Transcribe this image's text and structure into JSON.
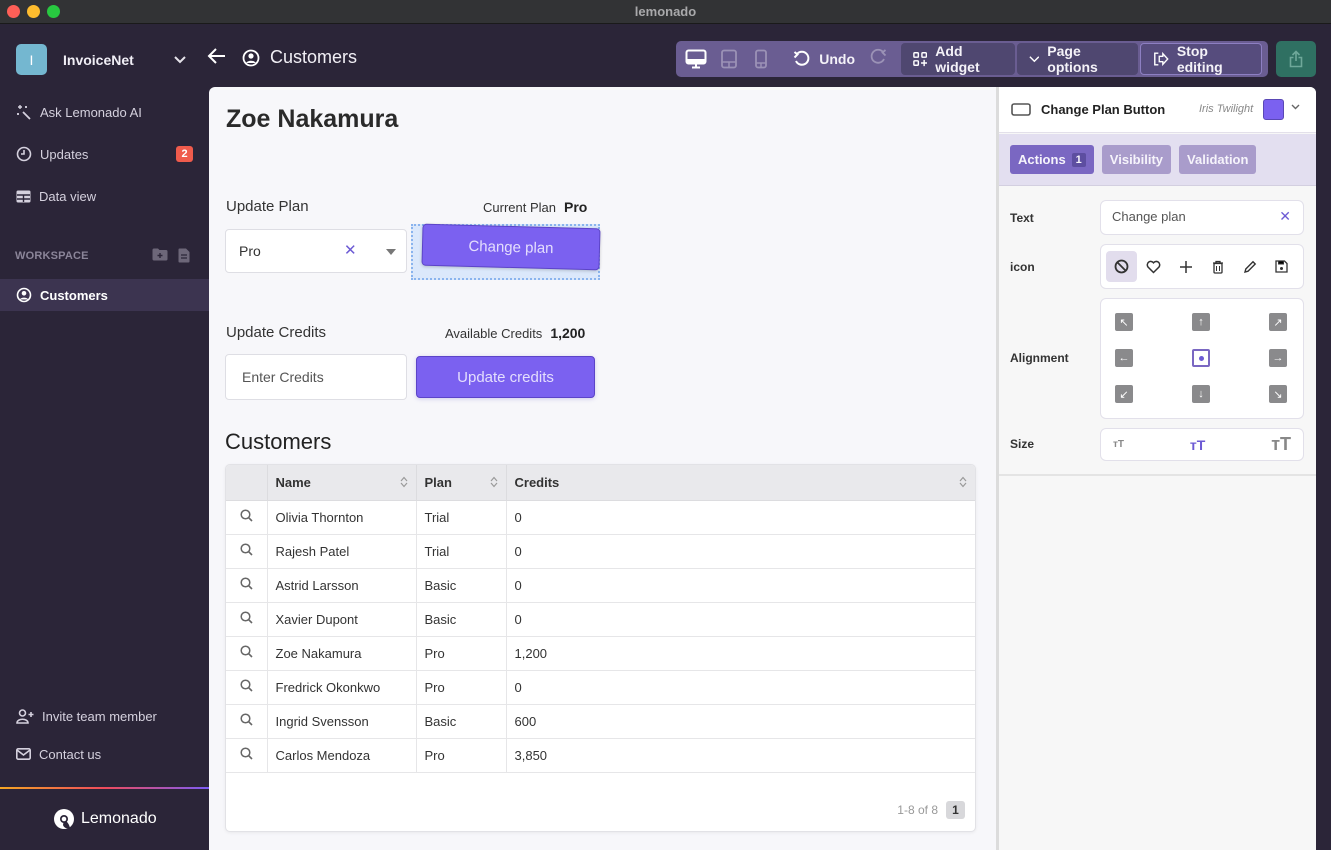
{
  "window": {
    "title": "lemonado"
  },
  "topbar": {
    "workspace_initial": "I",
    "workspace_name": "InvoiceNet",
    "page_title": "Customers",
    "toolbar": {
      "undo_label": "Undo",
      "add_widget_label": "Add widget",
      "page_options_label": "Page options",
      "stop_editing_label": "Stop editing"
    }
  },
  "sidebar": {
    "items": [
      {
        "label": "Ask Lemonado AI",
        "icon": "sparkle-wand-icon"
      },
      {
        "label": "Updates",
        "icon": "clock-icon",
        "badge": "2"
      },
      {
        "label": "Data view",
        "icon": "table-icon"
      }
    ],
    "workspace_label": "WORKSPACE",
    "pages": [
      {
        "label": "Customers",
        "icon": "user-circle-icon",
        "active": true
      }
    ],
    "footer": [
      {
        "label": "Invite team member",
        "icon": "user-plus-icon"
      },
      {
        "label": "Contact us",
        "icon": "mail-icon"
      }
    ],
    "brand": "Lemonado"
  },
  "canvas": {
    "customer_name": "Zoe Nakamura",
    "update_plan": {
      "label": "Update Plan",
      "current_plan_label": "Current Plan",
      "current_plan_value": "Pro",
      "select_value": "Pro",
      "button_label": "Change plan"
    },
    "update_credits": {
      "label": "Update Credits",
      "available_label": "Available Credits",
      "available_value": "1,200",
      "input_placeholder": "Enter Credits",
      "button_label": "Update credits"
    },
    "customers": {
      "title": "Customers",
      "columns": [
        "Name",
        "Plan",
        "Credits"
      ],
      "rows": [
        {
          "name": "Olivia Thornton",
          "plan": "Trial",
          "credits": "0"
        },
        {
          "name": "Rajesh Patel",
          "plan": "Trial",
          "credits": "0"
        },
        {
          "name": "Astrid Larsson",
          "plan": "Basic",
          "credits": "0"
        },
        {
          "name": "Xavier Dupont",
          "plan": "Basic",
          "credits": "0"
        },
        {
          "name": "Zoe Nakamura",
          "plan": "Pro",
          "credits": "1,200"
        },
        {
          "name": "Fredrick Okonkwo",
          "plan": "Pro",
          "credits": "0"
        },
        {
          "name": "Ingrid Svensson",
          "plan": "Basic",
          "credits": "600"
        },
        {
          "name": "Carlos Mendoza",
          "plan": "Pro",
          "credits": "3,850"
        }
      ],
      "pagination_text": "1-8 of 8",
      "current_page": "1"
    }
  },
  "panel": {
    "widget_title": "Change Plan Button",
    "theme_name": "Iris Twilight",
    "theme_color": "#7b61f0",
    "tabs": [
      {
        "label": "Actions",
        "count": "1",
        "active": true
      },
      {
        "label": "Visibility"
      },
      {
        "label": "Validation"
      }
    ],
    "props": {
      "text_label": "Text",
      "text_value": "Change plan",
      "icon_label": "icon",
      "icon_options": [
        "none-icon",
        "heart-icon",
        "plus-icon",
        "trash-icon",
        "pencil-icon",
        "save-icon"
      ],
      "alignment_label": "Alignment",
      "alignment_selected": "center",
      "size_label": "Size",
      "size_options": [
        "small",
        "medium",
        "large"
      ],
      "size_selected": "medium"
    }
  }
}
